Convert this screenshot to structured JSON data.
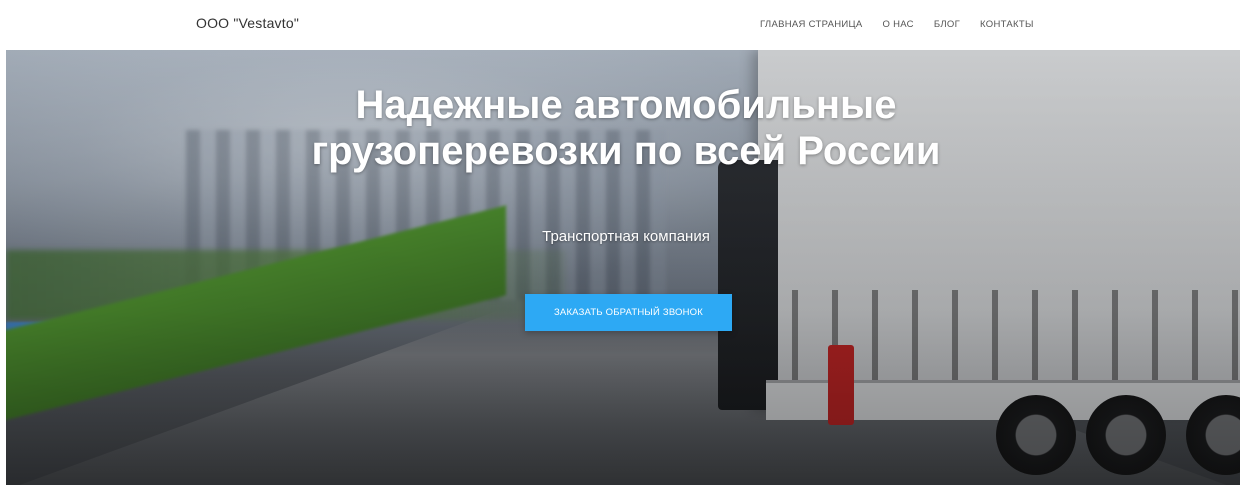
{
  "header": {
    "brand": "ООО \"Vestavto\"",
    "nav": [
      {
        "label": "ГЛАВНАЯ СТРАНИЦА"
      },
      {
        "label": "О НАС"
      },
      {
        "label": "БЛОГ"
      },
      {
        "label": "КОНТАКТЫ"
      }
    ]
  },
  "hero": {
    "title": "Надежные автомобильные грузоперевозки по всей России",
    "subtitle": "Транспортная компания",
    "cta_label": "ЗАКАЗАТЬ ОБРАТНЫЙ ЗВОНОК",
    "cta_color": "#2da9f4"
  }
}
